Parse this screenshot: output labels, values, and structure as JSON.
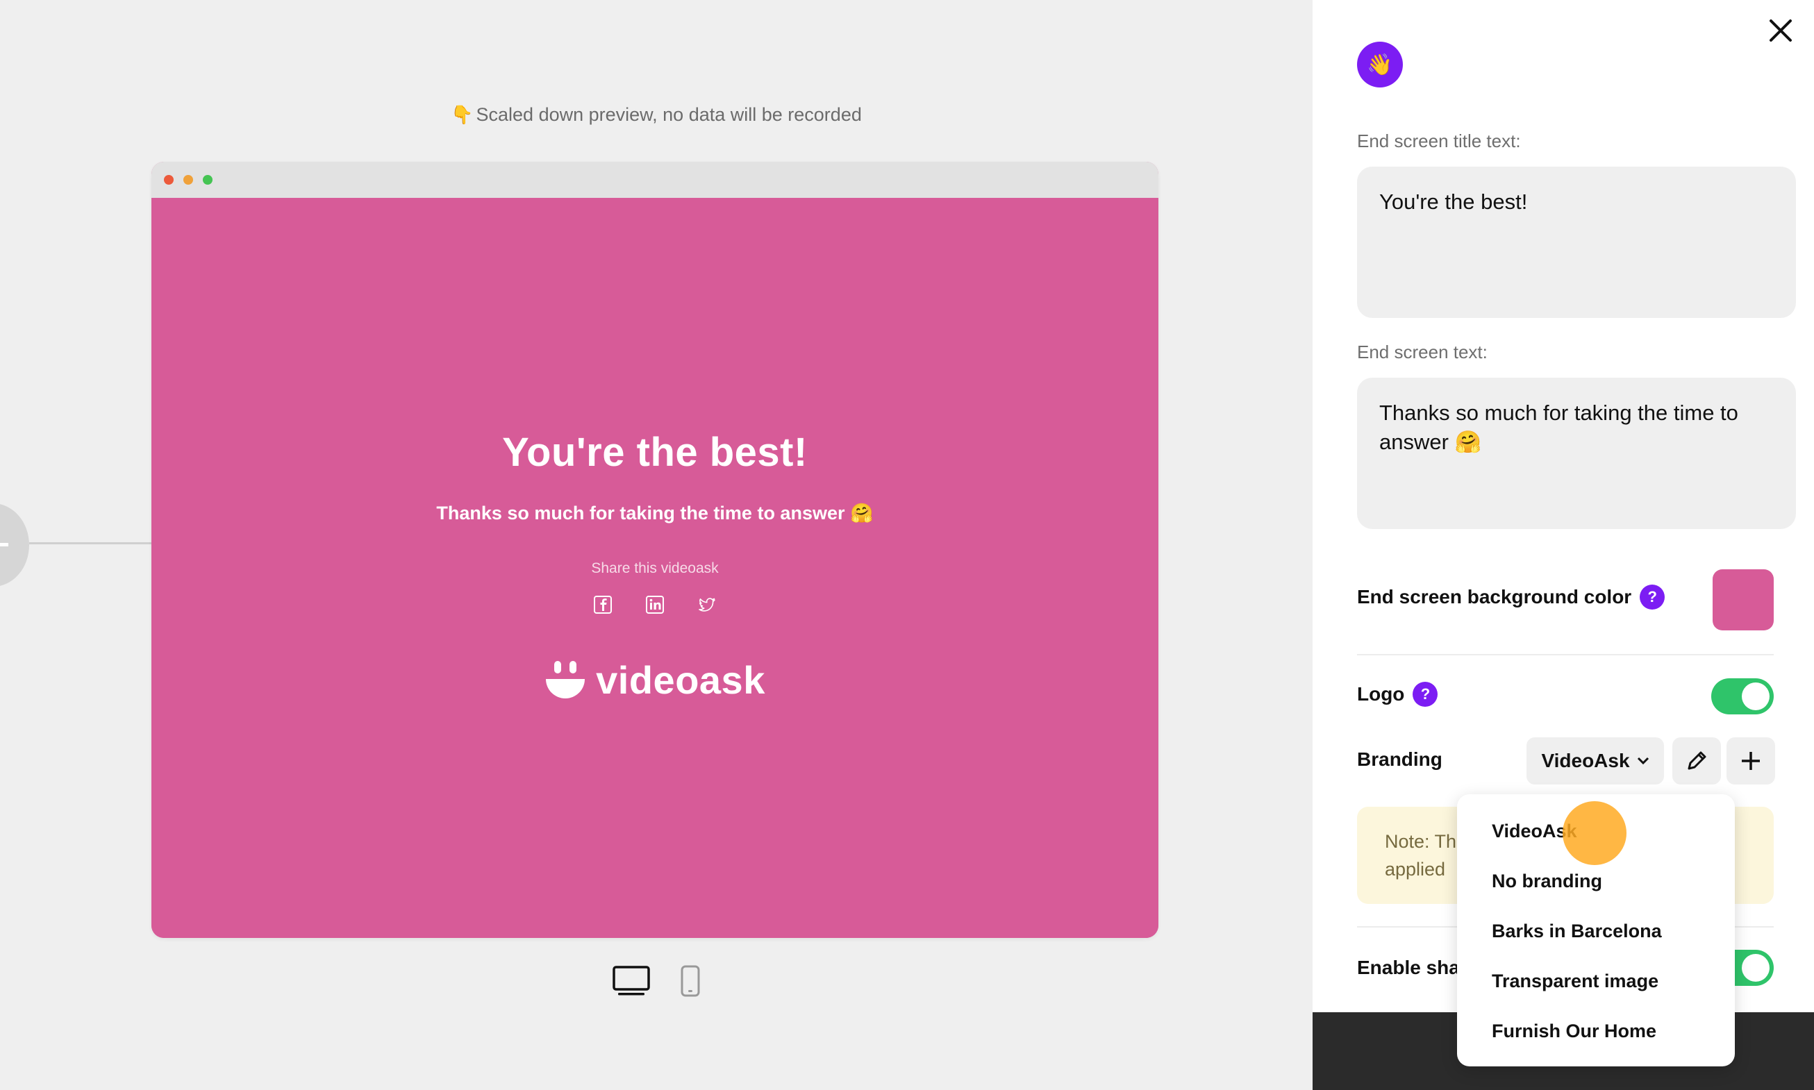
{
  "preview": {
    "note": "Scaled down preview, no data will be recorded",
    "hand_emoji": "👇",
    "end_title": "You're the best!",
    "end_text": "Thanks so much for taking the time to answer 🤗",
    "share_label": "Share this videoask",
    "logo_text": "videoask",
    "background_color": "#d75b98"
  },
  "panel": {
    "avatar_emoji": "👋",
    "title_label": "End screen title text:",
    "title_value": "You're the best!",
    "text_label": "End screen text:",
    "text_value": "Thanks so much for taking the time to answer 🤗",
    "bg_color_label": "End screen background color",
    "bg_color": "#d75b98",
    "logo_label": "Logo",
    "logo_enabled": true,
    "branding_label": "Branding",
    "branding_selected": "VideoAsk",
    "note_line1": "Note: Th",
    "note_line2": "applied",
    "enable_share_label": "Enable shar",
    "help_glyph": "?"
  },
  "branding_menu": {
    "items": [
      "VideoAsk",
      "No branding",
      "Barks in Barcelona",
      "Transparent image",
      "Furnish Our Home"
    ]
  },
  "colors": {
    "accent_purple": "#7c1df3",
    "toggle_green": "#2fc46a",
    "cursor_highlight": "#ffaa23"
  }
}
